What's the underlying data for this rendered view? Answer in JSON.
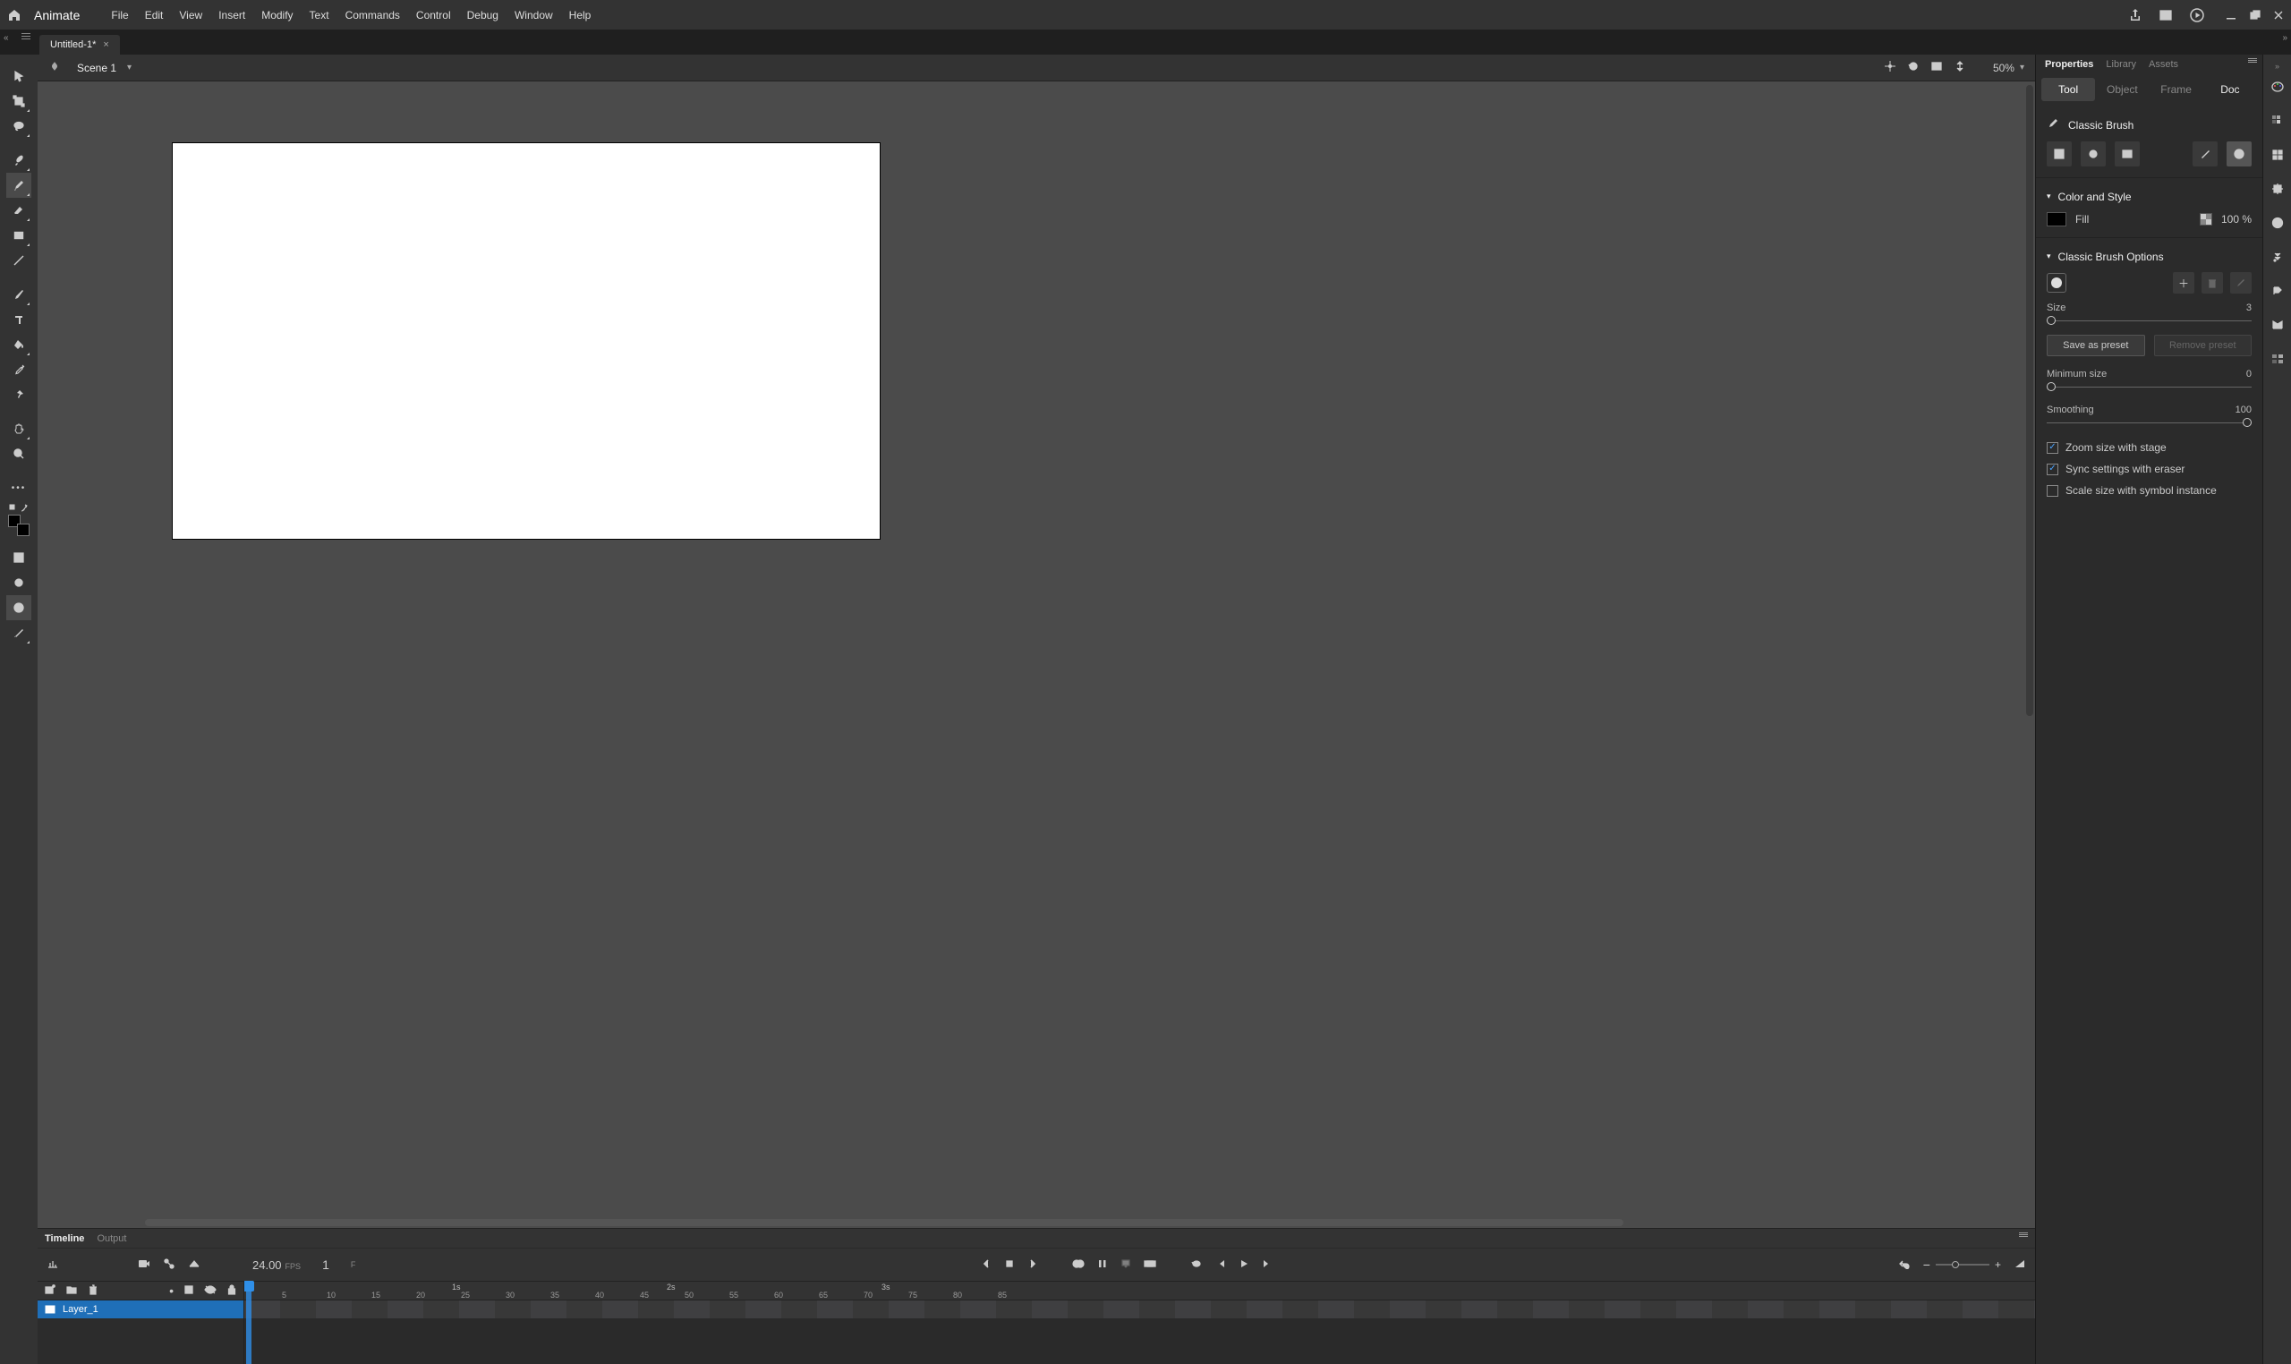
{
  "app": {
    "name": "Animate"
  },
  "menu": [
    "File",
    "Edit",
    "View",
    "Insert",
    "Modify",
    "Text",
    "Commands",
    "Control",
    "Debug",
    "Window",
    "Help"
  ],
  "document": {
    "tab_title": "Untitled-1*"
  },
  "scene": {
    "name": "Scene 1",
    "zoom": "50%"
  },
  "timeline": {
    "tabs": {
      "timeline": "Timeline",
      "output": "Output"
    },
    "fps": "24.00",
    "fps_label": "FPS",
    "current_frame": "1",
    "frame_flag": "F",
    "layer_name": "Layer_1",
    "second_marks": [
      "1s",
      "2s",
      "3s"
    ],
    "ticks": [
      "5",
      "10",
      "15",
      "20",
      "25",
      "30",
      "35",
      "40",
      "45",
      "50",
      "55",
      "60",
      "65",
      "70",
      "75",
      "80",
      "85"
    ]
  },
  "properties": {
    "tabs": {
      "properties": "Properties",
      "library": "Library",
      "assets": "Assets"
    },
    "subtabs": {
      "tool": "Tool",
      "object": "Object",
      "frame": "Frame",
      "doc": "Doc"
    },
    "tool_name": "Classic Brush",
    "headings": {
      "color_style": "Color and Style",
      "brush_options": "Classic Brush Options"
    },
    "fill_label": "Fill",
    "fill_opacity": "100 %",
    "size_label": "Size",
    "size_value": "3",
    "save_preset": "Save as preset",
    "remove_preset": "Remove preset",
    "min_size_label": "Minimum size",
    "min_size_value": "0",
    "smoothing_label": "Smoothing",
    "smoothing_value": "100",
    "checks": {
      "zoom_stage": "Zoom size with stage",
      "sync_eraser": "Sync settings with eraser",
      "scale_symbol": "Scale size with symbol instance"
    }
  }
}
